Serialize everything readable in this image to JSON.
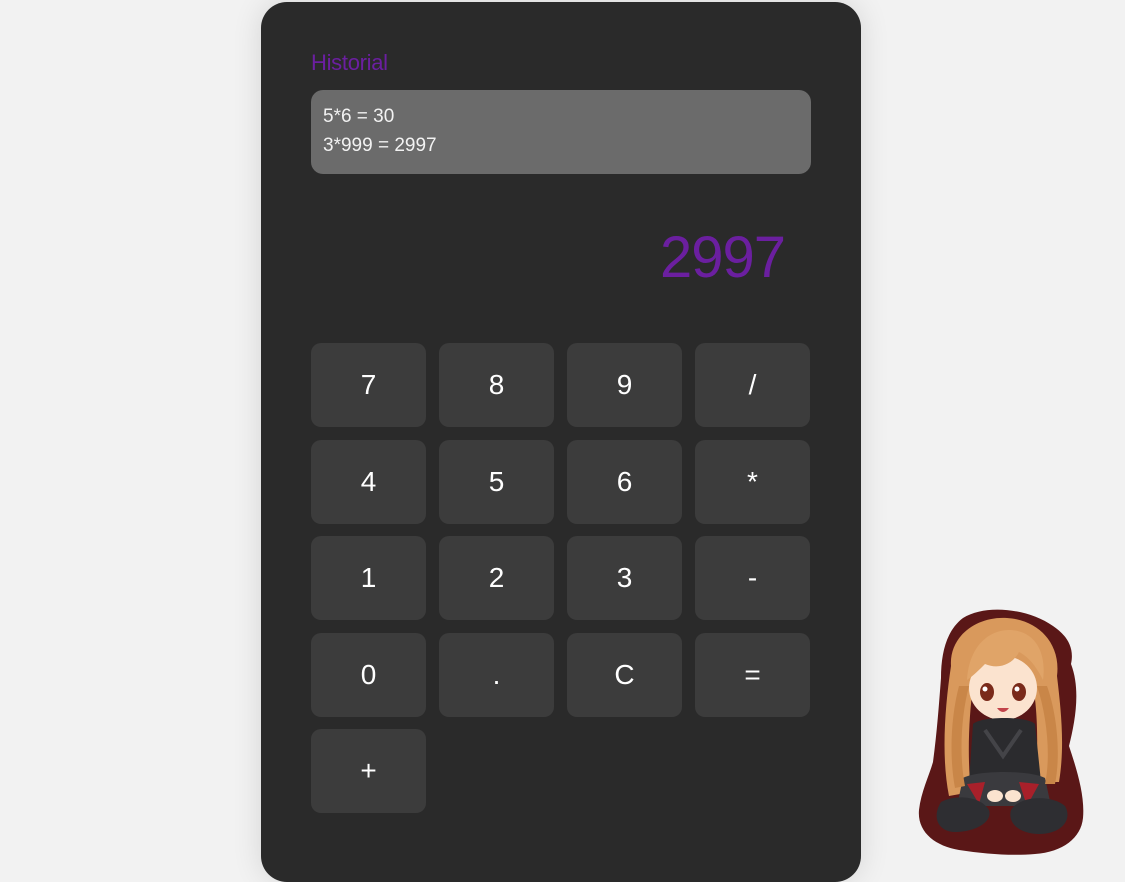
{
  "history": {
    "title": "Historial",
    "entries": [
      "5*6 = 30",
      "3*999 = 2997"
    ]
  },
  "display": {
    "value": "2997"
  },
  "keys": [
    "7",
    "8",
    "9",
    "/",
    "4",
    "5",
    "6",
    "*",
    "1",
    "2",
    "3",
    "-",
    "0",
    ".",
    "C",
    "=",
    "+"
  ],
  "colors": {
    "accent": "#6b1fa0",
    "panel": "#2a2a2a",
    "key": "#3c3c3c",
    "history_box": "#6b6b6b",
    "page_bg": "#f2f2f2"
  },
  "decoration": {
    "sticker": "anime-girl-sticker"
  }
}
